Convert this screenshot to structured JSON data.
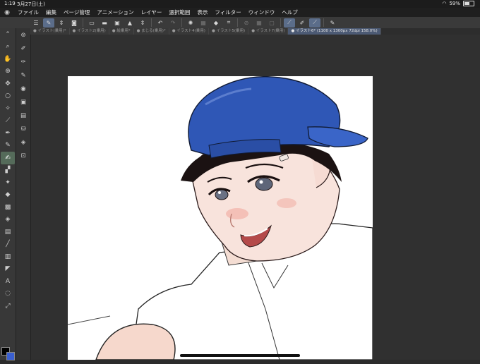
{
  "status": {
    "time": "1:19",
    "date": "3月27日(土)",
    "battery_percent": "59%",
    "battery_level": 0.59
  },
  "menubar": {
    "items": [
      "ファイル",
      "編集",
      "ページ管理",
      "アニメーション",
      "レイヤー",
      "選択範囲",
      "表示",
      "フィルター",
      "ウィンドウ",
      "ヘルプ"
    ]
  },
  "tabs": [
    {
      "label": "イラスト(乗用)*",
      "active": false
    },
    {
      "label": "イラスト2(乗用)",
      "active": false
    },
    {
      "label": "絵乗用*",
      "active": false
    },
    {
      "label": "まじる(乗用)*",
      "active": false
    },
    {
      "label": "イラスト4(乗用)",
      "active": false
    },
    {
      "label": "イラスト5(乗用)",
      "active": false
    },
    {
      "label": "イラスト7(乗用)",
      "active": false
    },
    {
      "label": "イラスト6* (1100 x 1300px 72dpi 158.0%)",
      "active": true
    }
  ],
  "colors": {
    "main": "#000000",
    "sub": "#3a5fd0",
    "accent": "#5b6d8a"
  }
}
